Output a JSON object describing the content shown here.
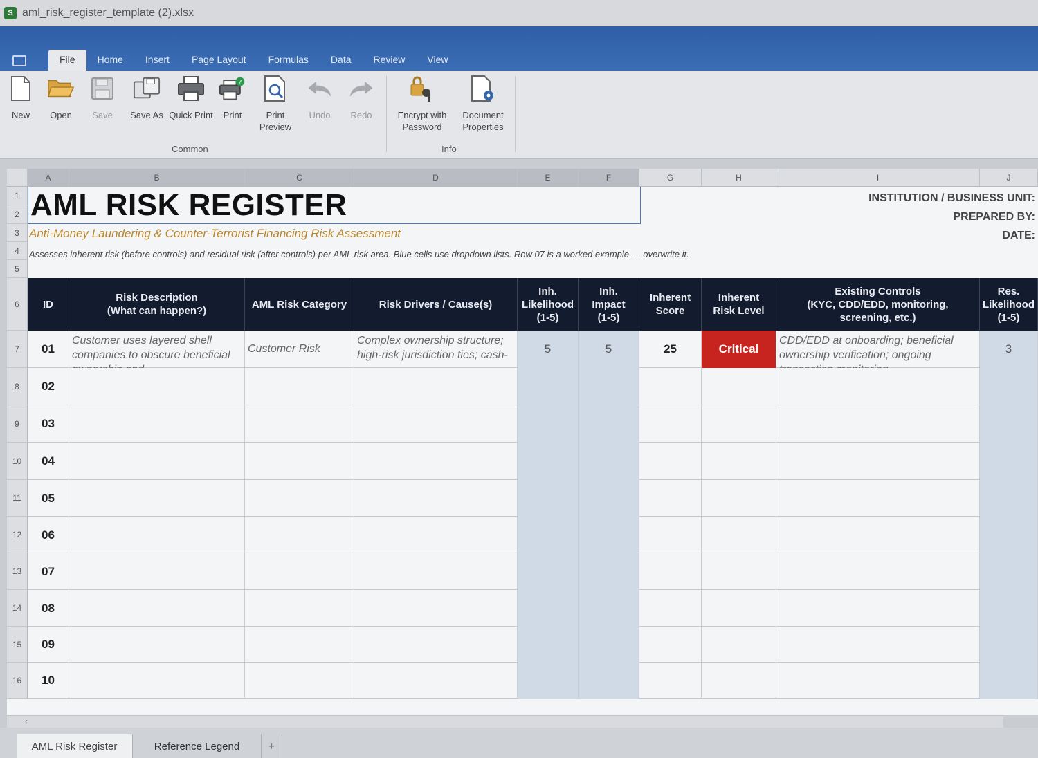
{
  "window": {
    "filename": "aml_risk_register_template (2).xlsx",
    "app_icon": "S"
  },
  "menu": {
    "tabs": [
      "File",
      "Home",
      "Insert",
      "Page Layout",
      "Formulas",
      "Data",
      "Review",
      "View"
    ],
    "active": "File"
  },
  "ribbon": {
    "buttons": [
      {
        "label": "New",
        "icon": "new-document-icon",
        "disabled": false
      },
      {
        "label": "Open",
        "icon": "folder-open-icon",
        "disabled": false
      },
      {
        "label": "Save",
        "icon": "floppy-disk-icon",
        "disabled": true
      },
      {
        "label": "Save As",
        "icon": "save-as-icon",
        "disabled": false
      },
      {
        "label": "Quick Print",
        "icon": "printer-icon",
        "disabled": false
      },
      {
        "label": "Print",
        "icon": "print-settings-icon",
        "disabled": false
      },
      {
        "label": "Print Preview",
        "icon": "print-preview-icon",
        "disabled": false
      },
      {
        "label": "Undo",
        "icon": "undo-icon",
        "disabled": true
      },
      {
        "label": "Redo",
        "icon": "redo-icon",
        "disabled": true
      },
      {
        "label": "Encrypt with Password",
        "icon": "lock-key-icon",
        "disabled": false
      },
      {
        "label": "Document Properties",
        "icon": "document-properties-icon",
        "disabled": false
      }
    ],
    "groups": {
      "common": "Common",
      "info": "Info"
    }
  },
  "sheet": {
    "columns": [
      "A",
      "B",
      "C",
      "D",
      "E",
      "F",
      "G",
      "H",
      "I",
      "J"
    ],
    "title": "AML RISK REGISTER",
    "subtitle": "Anti-Money Laundering & Counter-Terrorist Financing Risk Assessment",
    "note": "Assesses inherent risk (before controls) and residual risk (after controls) per AML risk area. Blue cells use dropdown lists. Row 07 is a worked example — overwrite it.",
    "meta": {
      "institution": "INSTITUTION / BUSINESS UNIT:",
      "prepared_by": "PREPARED BY:",
      "date": "DATE:"
    },
    "headers": [
      "ID",
      "Risk Description\n(What can happen?)",
      "AML Risk Category",
      "Risk Drivers / Cause(s)",
      "Inh.\nLikelihood\n(1-5)",
      "Inh.\nImpact\n(1-5)",
      "Inherent\nScore",
      "Inherent\nRisk Level",
      "Existing Controls\n(KYC, CDD/EDD, monitoring,\nscreening, etc.)",
      "Res.\nLikelihood\n(1-5)"
    ],
    "row_numbers": [
      "1",
      "2",
      "3",
      "4",
      "5",
      "6",
      "7",
      "8",
      "9",
      "10",
      "11",
      "12",
      "13",
      "14",
      "15",
      "16"
    ],
    "example": {
      "id": "01",
      "description": "Customer uses layered shell companies to obscure beneficial ownership and",
      "category": "Customer Risk",
      "drivers": "Complex ownership structure; high-risk jurisdiction ties; cash-",
      "likelihood": "5",
      "impact": "5",
      "score": "25",
      "level": "Critical",
      "controls": "CDD/EDD at onboarding; beneficial ownership verification; ongoing transaction monitoring",
      "res_likelihood": "3"
    },
    "ids": [
      "02",
      "03",
      "04",
      "05",
      "06",
      "07",
      "08",
      "09",
      "10"
    ]
  },
  "sheet_tabs": [
    "AML Risk Register",
    "Reference  Legend",
    "+"
  ],
  "colors": {
    "header_bg": "#131b2e",
    "critical": "#c8241f",
    "dropdown_blue": "#cfdae6",
    "subtitle": "#b9872e",
    "ribbon_blue": "#2f5fa6"
  }
}
